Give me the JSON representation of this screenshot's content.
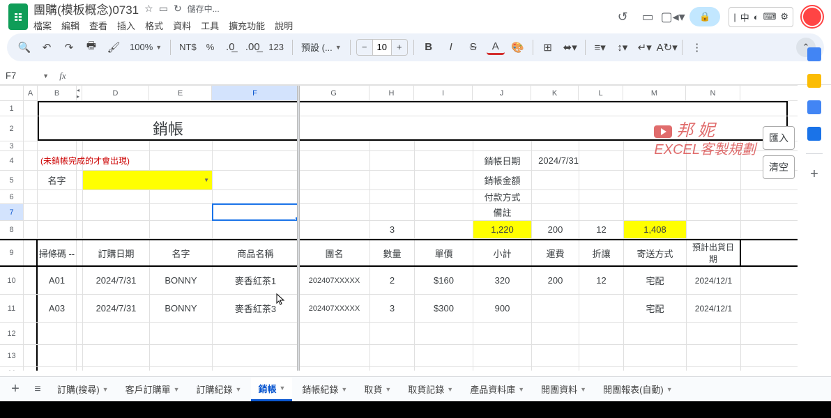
{
  "title": "團購(模板概念)0731",
  "saving": "儲存中...",
  "menus": [
    "檔案",
    "編輯",
    "查看",
    "插入",
    "格式",
    "資料",
    "工具",
    "擴充功能",
    "說明"
  ],
  "toolbar": {
    "zoom": "100%",
    "currency": "NT$",
    "percent": "%",
    "fmt1": ".0",
    "fmt2": ".00",
    "num": "123",
    "font_style_label": "預設 (...",
    "font_size": "10"
  },
  "namebox": "F7",
  "formula": "",
  "columns": [
    "",
    "A",
    "B",
    "C",
    "D",
    "E",
    "F",
    "G",
    "H",
    "I",
    "J",
    "K",
    "L",
    "M",
    "N"
  ],
  "col_hidden_marker": "◂  ▸",
  "row_heights": {
    "1": 22,
    "2": 36,
    "3": 14,
    "4": 28,
    "5": 28,
    "6": 20,
    "7": 24,
    "8": 26,
    "9": 40,
    "10": 40,
    "11": 40,
    "12": 32,
    "13": 32
  },
  "content": {
    "title_cell": "銷帳",
    "warning": "(未銷帳完成的才會出現)",
    "name_label": "名字",
    "labels_right": {
      "date": "銷帳日期",
      "amount": "銷帳金額",
      "payment": "付款方式",
      "note": "備註"
    },
    "date_value": "2024/7/31",
    "row8": {
      "h": "3",
      "j": "1,220",
      "k": "200",
      "l": "12",
      "m": "1,408"
    },
    "headers": [
      "掃條碼 --",
      "訂購日期",
      "名字",
      "商品名稱",
      "團名",
      "數量",
      "單價",
      "小計",
      "運費",
      "折讓",
      "寄送方式",
      "預計出貨日期"
    ],
    "rows": [
      {
        "code": "A01",
        "date": "2024/7/31",
        "name": "BONNY",
        "product": "麥香紅茶1",
        "group": "202407XXXXX",
        "qty": "2",
        "price": "$160",
        "subtotal": "320",
        "ship": "200",
        "discount": "12",
        "deliver": "宅配",
        "est": "2024/12/1"
      },
      {
        "code": "A03",
        "date": "2024/7/31",
        "name": "BONNY",
        "product": "麥香紅茶3",
        "group": "202407XXXXX",
        "qty": "3",
        "price": "$300",
        "subtotal": "900",
        "ship": "",
        "discount": "",
        "deliver": "宅配",
        "est": "2024/12/1"
      }
    ]
  },
  "side_buttons": {
    "import": "匯入",
    "clear": "清空"
  },
  "watermark": {
    "line1": "邦 妮",
    "line2": "EXCEL客製規劃"
  },
  "ime": "中",
  "sheet_tabs": [
    "訂購(搜尋)",
    "客戶訂購單",
    "訂購紀錄",
    "銷帳",
    "銷帳紀錄",
    "取貨",
    "取貨記錄",
    "產品資料庫",
    "開團資料",
    "開團報表(自動)"
  ],
  "active_tab_index": 3,
  "chart_data": null
}
